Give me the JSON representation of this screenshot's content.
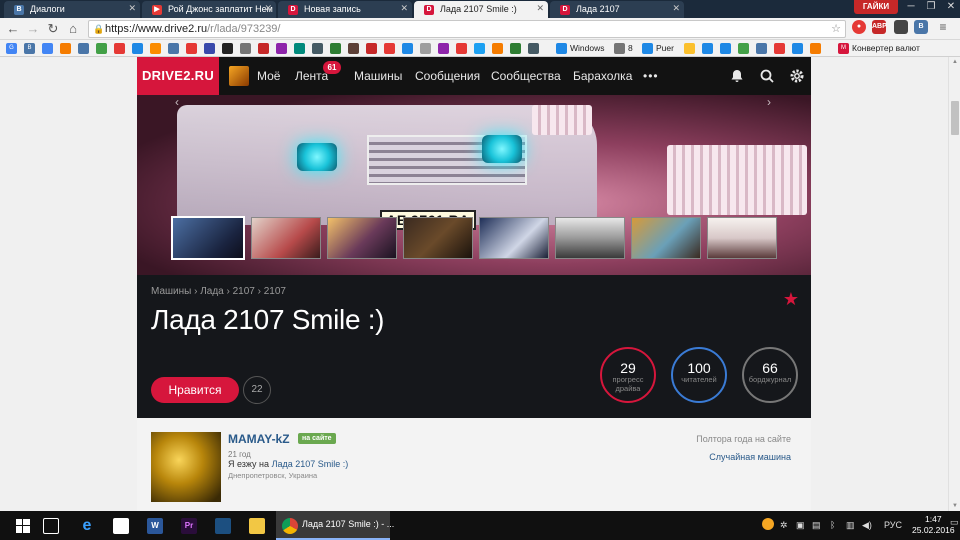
{
  "browser": {
    "tabs": [
      {
        "title": "Диалоги",
        "color": "#4a76a8",
        "glyph": "B"
      },
      {
        "title": "Рой Джонс заплатит Нем",
        "color": "#e53935",
        "glyph": "▶"
      },
      {
        "title": "Новая запись",
        "color": "#d6163c",
        "glyph": "D"
      },
      {
        "title": "Лада 2107 Smile :)",
        "color": "#d6163c",
        "glyph": "D"
      },
      {
        "title": "Лада 2107",
        "color": "#d6163c",
        "glyph": "D"
      }
    ],
    "gaiki_label": "ГАЙКИ",
    "url_domain": "https://www.drive2.ru",
    "url_path": "/r/lada/973239/",
    "bookmarks": [
      {
        "label": "Windows"
      },
      {
        "label": "8"
      },
      {
        "label": "Puer"
      },
      {
        "label": "Конвертер валют"
      }
    ]
  },
  "site": {
    "logo": "DRIVE2.RU",
    "nav": [
      {
        "label": "Моё"
      },
      {
        "label": "Лента"
      },
      {
        "label": "Машины"
      },
      {
        "label": "Сообщения"
      },
      {
        "label": "Сообщества"
      },
      {
        "label": "Барахолка"
      },
      {
        "label": "•••"
      }
    ],
    "feed_badge": "61",
    "hero": {
      "plate": "AE 9761 BA"
    },
    "breadcrumb": "Машины › Лада › 2107 › 2107",
    "car_title": "Лада 2107 Smile :)",
    "like_label": "Нравится",
    "like_count": "22",
    "stats": [
      {
        "value": "29",
        "label1": "прогресс",
        "label2": "драйва",
        "color": "#d6163c"
      },
      {
        "value": "100",
        "label1": "читателей",
        "label2": "",
        "color": "#3a7bd5"
      },
      {
        "value": "66",
        "label1": "борджурнал",
        "label2": "",
        "color": "#777777"
      }
    ],
    "owner": {
      "name": "MAMAY-kZ",
      "status": "на сайте",
      "age": "21 год",
      "drive_prefix": "Я езжу на",
      "drive_link": "Лада 2107 Smile :)",
      "city": "Днепропетровск, Украина",
      "since": "Полтора года на сайте",
      "random_car": "Случайная машина"
    }
  },
  "taskbar": {
    "chrome_label": "Лада 2107 Smile :) - ...",
    "lang": "РУС",
    "time": "1:47",
    "date": "25.02.2016"
  }
}
